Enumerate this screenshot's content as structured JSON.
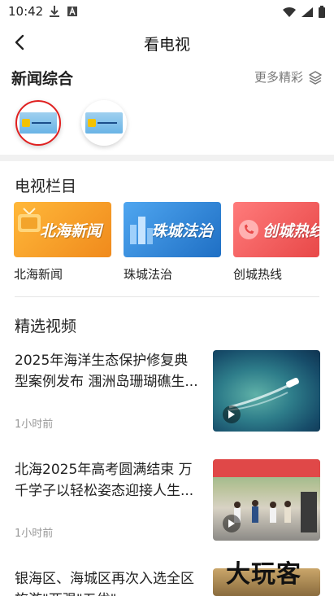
{
  "status_bar": {
    "time": "10:42"
  },
  "header": {
    "title": "看电视"
  },
  "channels": {
    "heading": "新闻综合",
    "more_label": "更多精彩"
  },
  "tv_columns": {
    "heading": "电视栏目",
    "items": [
      {
        "label": "北海新闻",
        "banner_text": "北海新闻"
      },
      {
        "label": "珠城法治",
        "banner_text": "珠城法治"
      },
      {
        "label": "创城热线",
        "banner_text": "创城热线"
      }
    ]
  },
  "featured": {
    "heading": "精选视频",
    "items": [
      {
        "title": "2025年海洋生态保护修复典型案例发布 涠洲岛珊瑚礁生...",
        "time": "1小时前"
      },
      {
        "title": "北海2025年高考圆满结束 万千学子以轻松姿态迎接人生...",
        "time": "1小时前"
      },
      {
        "title": "银海区、海城区再次入选全区旅游\"两强\"五优\"",
        "time": ""
      }
    ]
  },
  "watermark": "大玩客",
  "colors": {
    "selected_border": "#e02020",
    "news_banner": "#f6a329",
    "law_banner": "#2e86d6",
    "hotline_banner": "#ef5a5a"
  }
}
